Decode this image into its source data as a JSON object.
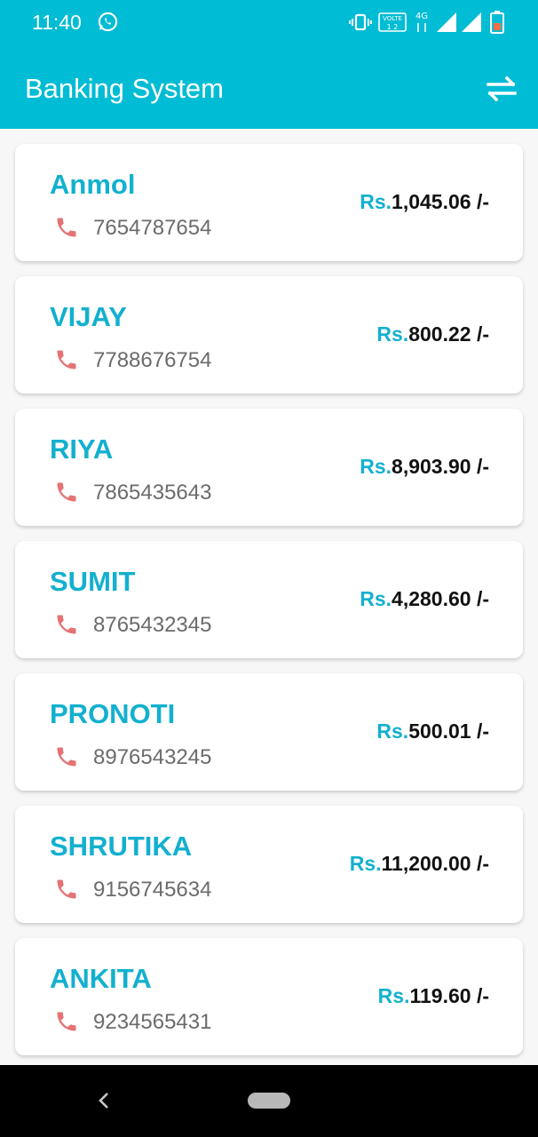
{
  "status_bar": {
    "time": "11:40",
    "icons": [
      "whatsapp-icon",
      "vibrate-icon",
      "volte-icon",
      "4g-icon",
      "signal-icon",
      "signal-icon",
      "battery-icon"
    ],
    "volte_text": "VOLTE",
    "network_text": "4G"
  },
  "app_bar": {
    "title": "Banking System",
    "action_icon": "swap-arrows-icon"
  },
  "accounts": [
    {
      "name": "Anmol",
      "phone": "7654787654",
      "currency": "Rs.",
      "amount": "1,045.06 /-"
    },
    {
      "name": "VIJAY",
      "phone": "7788676754",
      "currency": "Rs.",
      "amount": "800.22 /-"
    },
    {
      "name": "RIYA",
      "phone": "7865435643",
      "currency": "Rs.",
      "amount": "8,903.90 /-"
    },
    {
      "name": "SUMIT",
      "phone": "8765432345",
      "currency": "Rs.",
      "amount": "4,280.60 /-"
    },
    {
      "name": "PRONOTI",
      "phone": "8976543245",
      "currency": "Rs.",
      "amount": "500.01 /-"
    },
    {
      "name": "SHRUTIKA",
      "phone": "9156745634",
      "currency": "Rs.",
      "amount": "11,200.00 /-"
    },
    {
      "name": "ANKITA",
      "phone": "9234565431",
      "currency": "Rs.",
      "amount": "119.60 /-"
    }
  ],
  "colors": {
    "primary": "#00bcd4",
    "accent_text": "#13b0cf",
    "phone_icon": "#e57373",
    "nav_bar": "#000000"
  },
  "nav_bar": {
    "back_icon": "back-chevron-icon",
    "home_icon": "home-pill-icon"
  }
}
